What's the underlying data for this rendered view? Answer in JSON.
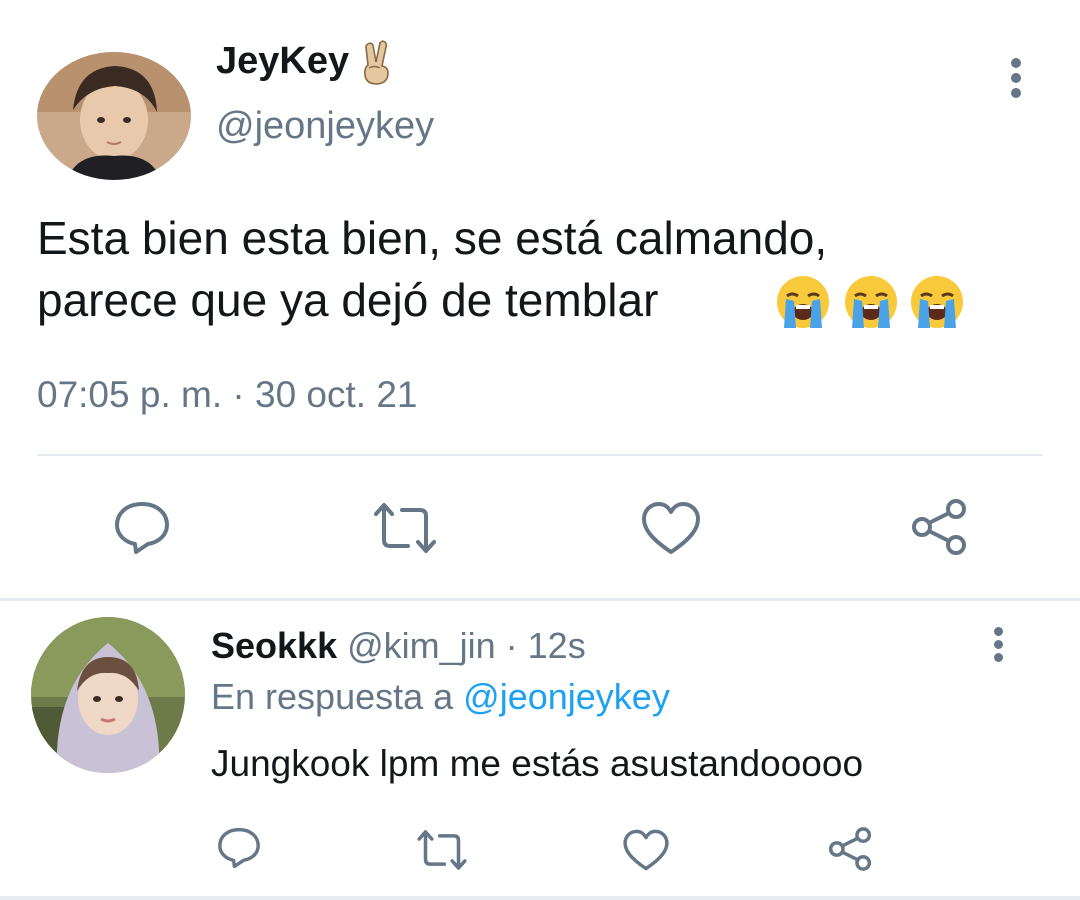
{
  "tweet": {
    "display_name": "JeyKey",
    "name_emoji": "victory-hand-emoji",
    "handle": "@jeonjeykey",
    "text_line1": "Esta bien esta bien, se está calmando,",
    "text_line2": "parece que ya dejó de temblar",
    "text_emojis": [
      "loudly-crying-face-emoji",
      "loudly-crying-face-emoji",
      "loudly-crying-face-emoji"
    ],
    "timestamp": "07:05 p. m. · 30 oct. 21",
    "actions": [
      "reply-icon",
      "retweet-icon",
      "like-icon",
      "share-icon"
    ]
  },
  "reply": {
    "display_name": "Seokkk",
    "handle_time": " @kim_jin · 12s",
    "context_prefix": "En respuesta a ",
    "context_mention": "@jeonjeykey",
    "text": "Jungkook lpm me estás asustandooooo",
    "actions": [
      "reply-icon",
      "retweet-icon",
      "like-icon",
      "share-icon"
    ]
  },
  "colors": {
    "text_primary": "#14171a",
    "text_secondary": "#657786",
    "link": "#1da1f2",
    "divider": "#e6ecf0"
  }
}
